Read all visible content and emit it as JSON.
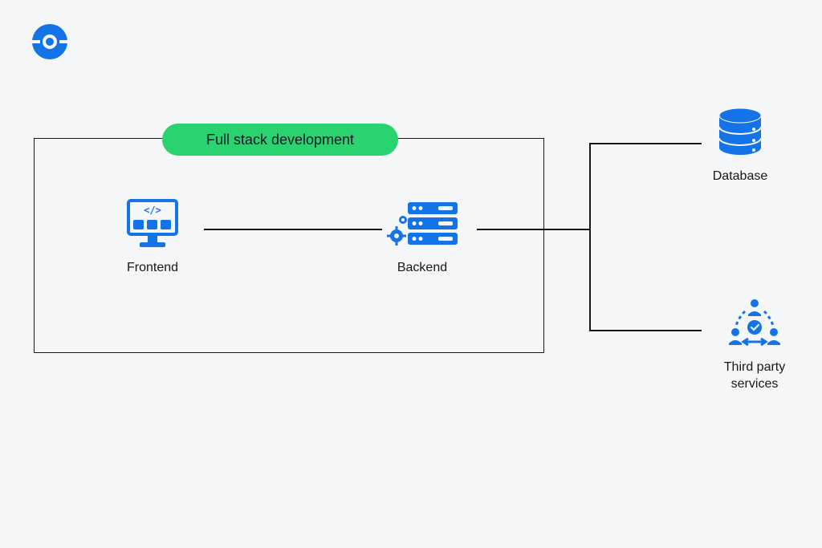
{
  "header": {
    "title_pill": "Full stack development"
  },
  "nodes": {
    "frontend": {
      "label": "Frontend",
      "icon": "monitor-code-icon"
    },
    "backend": {
      "label": "Backend",
      "icon": "server-gears-icon"
    },
    "database": {
      "label": "Database",
      "icon": "database-icon"
    },
    "third_party": {
      "label": "Third party services",
      "icon": "team-icon"
    }
  },
  "colors": {
    "accent": "#1473e6",
    "pill": "#2ad36f",
    "line": "#171717",
    "bg": "#f5f6f8"
  },
  "diagram": {
    "container_label": "Full stack development",
    "edges": [
      {
        "from": "frontend",
        "to": "backend"
      },
      {
        "from": "backend",
        "to": "database"
      },
      {
        "from": "backend",
        "to": "third_party"
      }
    ]
  }
}
